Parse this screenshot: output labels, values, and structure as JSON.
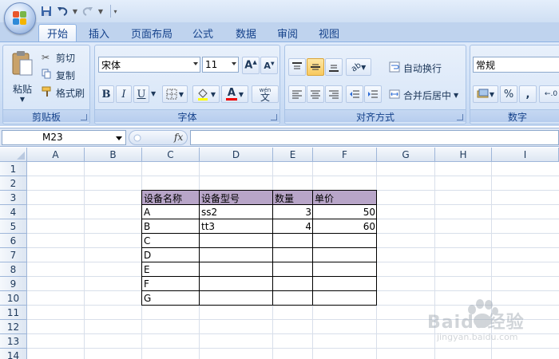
{
  "quick_access": {
    "save": "save-icon",
    "undo": "undo-icon",
    "redo": "redo-icon",
    "customize": "▾"
  },
  "tabs": [
    "开始",
    "插入",
    "页面布局",
    "公式",
    "数据",
    "审阅",
    "视图"
  ],
  "ribbon": {
    "clipboard": {
      "paste": "粘贴",
      "cut": "剪切",
      "copy": "复制",
      "format_painter": "格式刷",
      "label": "剪贴板"
    },
    "font": {
      "name": "宋体",
      "size": "11",
      "bold": "B",
      "italic": "I",
      "underline": "U",
      "font_color": "A",
      "phonetic": "wén",
      "label": "字体"
    },
    "alignment": {
      "wrap_text": "自动换行",
      "merge_center": "合并后居中",
      "label": "对齐方式"
    },
    "number": {
      "format": "常规",
      "percent": "%",
      "comma": ",",
      "label": "数字"
    }
  },
  "formula_bar": {
    "name_box": "M23",
    "fx": "fx",
    "formula": ""
  },
  "columns": [
    "A",
    "B",
    "C",
    "D",
    "E",
    "F",
    "G",
    "H",
    "I"
  ],
  "rows": [
    "1",
    "2",
    "3",
    "4",
    "5",
    "6",
    "7",
    "8",
    "9",
    "10",
    "11",
    "12",
    "13",
    "14"
  ],
  "table": {
    "headers": [
      "设备名称",
      "设备型号",
      "数量",
      "单价"
    ],
    "rows": [
      [
        "A",
        "ss2",
        "3",
        "50"
      ],
      [
        "B",
        "tt3",
        "4",
        "60"
      ],
      [
        "C",
        "",
        "",
        ""
      ],
      [
        "D",
        "",
        "",
        ""
      ],
      [
        "E",
        "",
        "",
        ""
      ],
      [
        "F",
        "",
        "",
        ""
      ],
      [
        "G",
        "",
        "",
        ""
      ]
    ]
  },
  "header_fill": "#b8a5c8",
  "watermark": {
    "brand": "Baidu经验",
    "sub": "jingyan.baidu.com"
  }
}
